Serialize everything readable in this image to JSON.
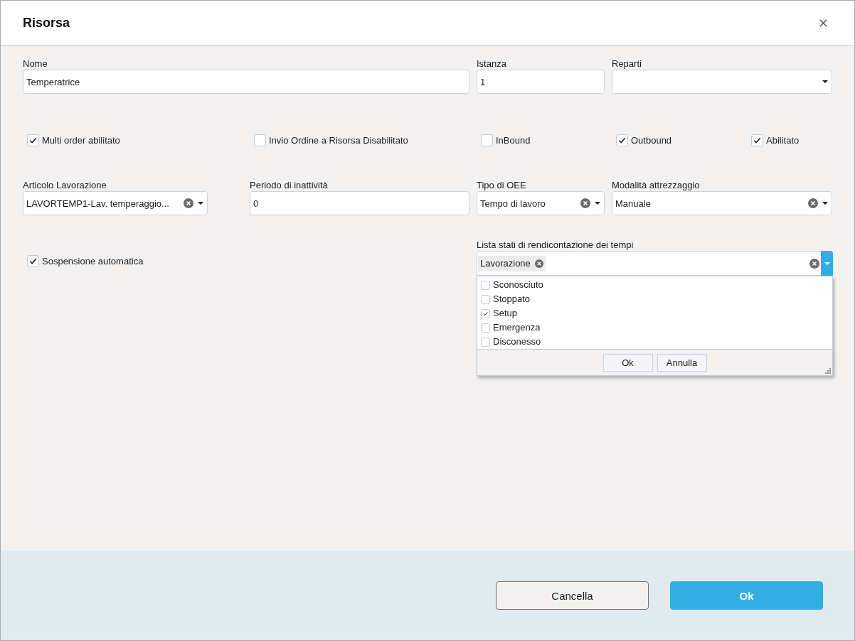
{
  "window": {
    "title": "Risorsa"
  },
  "main_fields": [
    {
      "kind": "text",
      "label": "Nome",
      "value": "Temperatrice"
    },
    {
      "kind": "text",
      "label": "Istanza",
      "value": "1"
    },
    {
      "kind": "select",
      "label": "Reparti"
    }
  ],
  "options": [
    {
      "label": "Multi order abilitato",
      "checked": true
    },
    {
      "label": "Invio Ordine a Risorsa Disabilitato",
      "checked": false
    },
    {
      "label": "InBound",
      "checked": false
    },
    {
      "label": "Outbound",
      "checked": true
    },
    {
      "label": "Abilitato",
      "checked": true
    }
  ],
  "detail_fields": [
    {
      "kind": "select",
      "label": "Articolo Lavorazione",
      "value": "LAVORTEMP1-Lav. temperaggio..."
    },
    {
      "kind": "text",
      "label": "Periodo di inattività",
      "value": "0"
    },
    {
      "kind": "select",
      "label": "Tipo di OEE",
      "value": "Tempo di lavoro"
    },
    {
      "kind": "select",
      "label": "Modalità attrezzaggio",
      "value": "Manuale"
    }
  ],
  "auto_suspend": {
    "label": "Sospensione automatica",
    "checked": true
  },
  "time_states": {
    "label": "Lista stati di rendicontazione dei tempi",
    "tags": [
      "Lavorazione"
    ],
    "expanded": true,
    "options": [
      {
        "label": "Sconosciuto",
        "checked": false
      },
      {
        "label": "Stoppato",
        "checked": false
      },
      {
        "label": "Setup",
        "checked": true
      },
      {
        "label": "Emergenza",
        "checked": false
      },
      {
        "label": "Disconesso",
        "checked": false
      }
    ],
    "buttons": [
      "Ok",
      "Annulla"
    ]
  },
  "footer_buttons": [
    {
      "label": "Cancella",
      "kind": "secondary"
    },
    {
      "label": "Ok",
      "kind": "primary"
    }
  ]
}
